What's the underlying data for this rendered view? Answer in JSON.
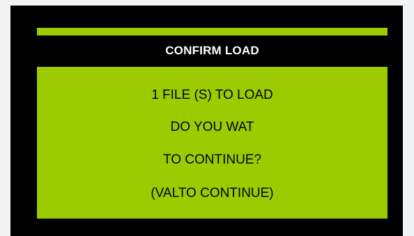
{
  "dialog": {
    "title": "CONFIRM LOAD",
    "lines": [
      "1 FILE (S) TO LOAD",
      "DO YOU WAT",
      "TO CONTINUE?",
      "(VALTO CONTINUE)"
    ]
  },
  "colors": {
    "panel_background": "#000000",
    "accent_green": "#9ccb00",
    "title_text": "#ffffff",
    "body_text": "#000000"
  }
}
